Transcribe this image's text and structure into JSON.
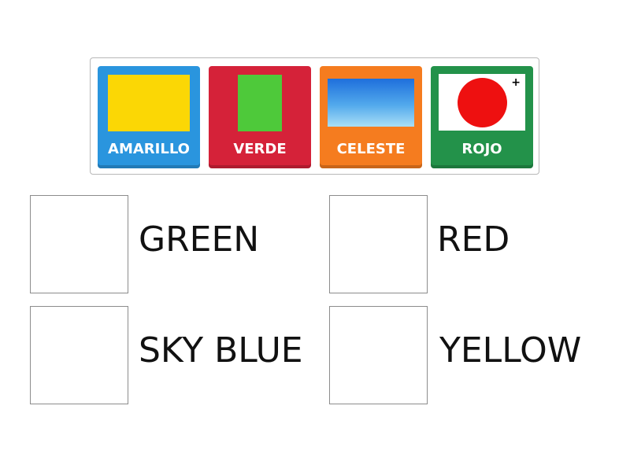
{
  "tiles": [
    {
      "label": "AMARILLO",
      "color": "#2a95de",
      "image": "yellow-rectangle"
    },
    {
      "label": "VERDE",
      "color": "#d52239",
      "image": "green-rectangle"
    },
    {
      "label": "CELESTE",
      "color": "#f57c1f",
      "image": "sky-blue-gradient"
    },
    {
      "label": "ROJO",
      "color": "#23924a",
      "image": "japan-flag"
    }
  ],
  "zoom_icon": "+",
  "answers": [
    {
      "label": "GREEN"
    },
    {
      "label": "RED"
    },
    {
      "label": "SKY BLUE"
    },
    {
      "label": "YELLOW"
    }
  ]
}
